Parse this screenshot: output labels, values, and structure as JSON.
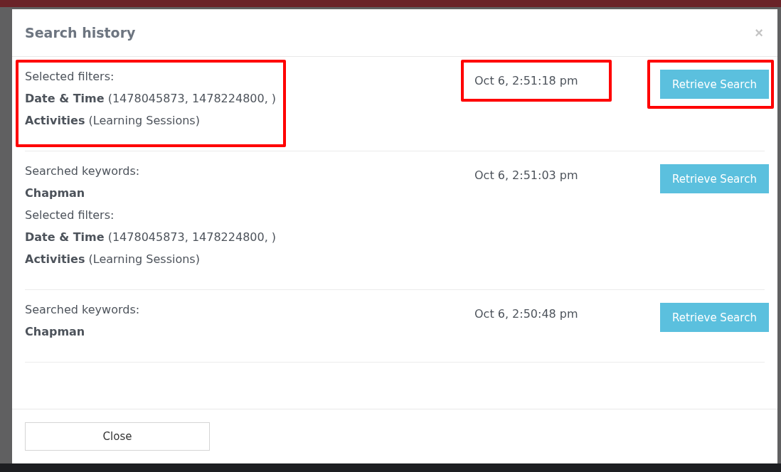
{
  "dialog": {
    "title": "Search history",
    "close": "×",
    "entries": [
      {
        "highlighted": true,
        "lines": [
          {
            "kind": "label",
            "text": "Selected filters:"
          },
          {
            "kind": "filter",
            "text": "**Date & Time** (1478045873, 1478224800, )"
          },
          {
            "kind": "filter",
            "text": "**Activities** (Learning Sessions)"
          }
        ],
        "time": "Oct 6, 2:51:18 pm",
        "button": "Retrieve Search"
      },
      {
        "highlighted": false,
        "lines": [
          {
            "kind": "label",
            "text": "Searched keywords:"
          },
          {
            "kind": "keyword",
            "text": "Chapman"
          },
          {
            "kind": "label",
            "text": "Selected filters:"
          },
          {
            "kind": "filter",
            "text": "**Date & Time** (1478045873, 1478224800, )"
          },
          {
            "kind": "filter",
            "text": "**Activities** (Learning Sessions)"
          }
        ],
        "time": "Oct 6, 2:51:03 pm",
        "button": "Retrieve Search"
      },
      {
        "highlighted": false,
        "lines": [
          {
            "kind": "label",
            "text": "Searched keywords:"
          },
          {
            "kind": "keyword",
            "text": "Chapman"
          }
        ],
        "time": "Oct 6, 2:50:48 pm",
        "button": "Retrieve Search"
      }
    ],
    "footer_button": "Close"
  }
}
